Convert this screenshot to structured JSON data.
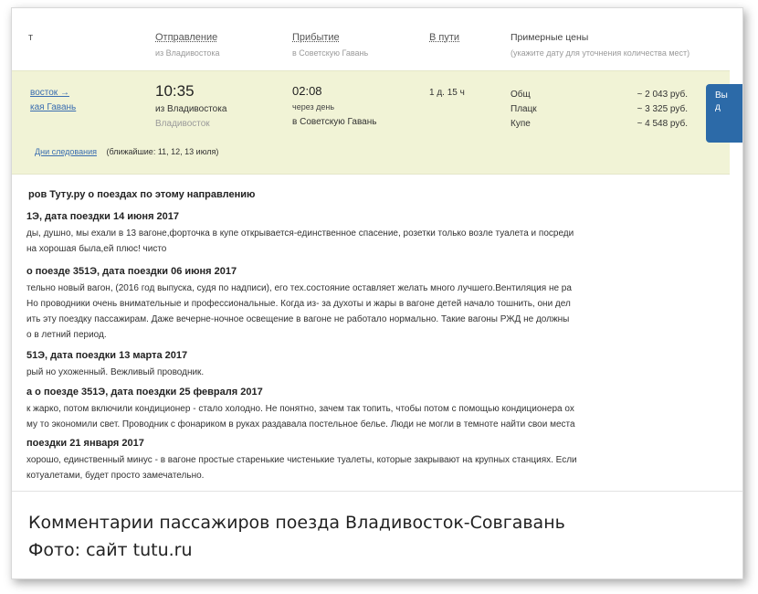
{
  "header": {
    "first_col": "т",
    "departure": {
      "title": "Отправление",
      "sub": "из Владивостока"
    },
    "arrival": {
      "title": "Прибытие",
      "sub": "в Советскую Гавань"
    },
    "travel": {
      "title": "В пути"
    },
    "prices": {
      "title": "Примерные цены",
      "sub": "(укажите дату для уточнения количества мест)"
    }
  },
  "train": {
    "route_from": "восток →",
    "route_to": "кая Гавань",
    "dep_time": "10:35",
    "dep_station": "из Владивостока",
    "dep_station2": "Владивосток",
    "arr_time": "02:08",
    "arr_note": "через день",
    "arr_station": "в Советскую Гавань",
    "duration": "1 д. 15 ч",
    "classes": [
      {
        "name": "Общ",
        "price": "~ 2 043 руб."
      },
      {
        "name": "Плацк",
        "price": "~ 3 325 руб."
      },
      {
        "name": "Купе",
        "price": "~ 4 548 руб."
      }
    ],
    "buy_label_1": "Вы",
    "buy_label_2": "д",
    "days_link": "Дни следования",
    "days_note": "(ближайшие: 11, 12, 13 июля)"
  },
  "reviews": {
    "title": "ров Туту.ру о поездах по этому направлению",
    "items": [
      {
        "head": "1Э, дата поездки 14 июня 2017",
        "lines": [
          "ды, душно, мы ехали в 13 вагоне,форточка в купе открывается-единственное спасение, розетки только возле туалета и посреди",
          "на хорошая была,ей плюс! чисто"
        ]
      },
      {
        "head": "о поезде 351Э, дата поездки 06 июня 2017",
        "lines": [
          "тельно новый вагон, (2016 год выпуска, судя по надписи), его тех.состояние оставляет желать много лучшего.Вентиляция не ра",
          " Но проводники очень внимательные и профессиональные. Когда из- за духоты и жары в вагоне детей начало тошнить, они дел",
          "ить эту поездку пассажирам. Даже вечерне-ночное освещение в вагоне не работало нормально. Такие вагоны РЖД не должны",
          "о в летний период."
        ]
      },
      {
        "head": "51Э, дата поездки 13 марта 2017",
        "lines": [
          "рый но ухоженный. Вежливый проводник."
        ]
      },
      {
        "head": "а о поезде 351Э, дата поездки 25 февраля 2017",
        "lines": [
          "к жарко, потом включили кондиционер - стало холодно. Не понятно, зачем так топить, чтобы потом с помощью кондиционера ох",
          "му то экономили свет. Проводник с фонариком в руках раздавала постельное белье. Люди не могли в темноте найти свои места"
        ]
      },
      {
        "head": "поездки 21 января 2017",
        "lines": [
          "хорошо, единственный минус - в вагоне простые старенькие чистенькие туалеты, которые закрывают на крупных станциях. Если",
          "котуалетами, будет просто замечательно."
        ]
      }
    ]
  },
  "caption": {
    "line1": "Комментарии пассажиров поезда Владивосток-Совгавань",
    "line2": "Фото: сайт tutu.ru"
  }
}
